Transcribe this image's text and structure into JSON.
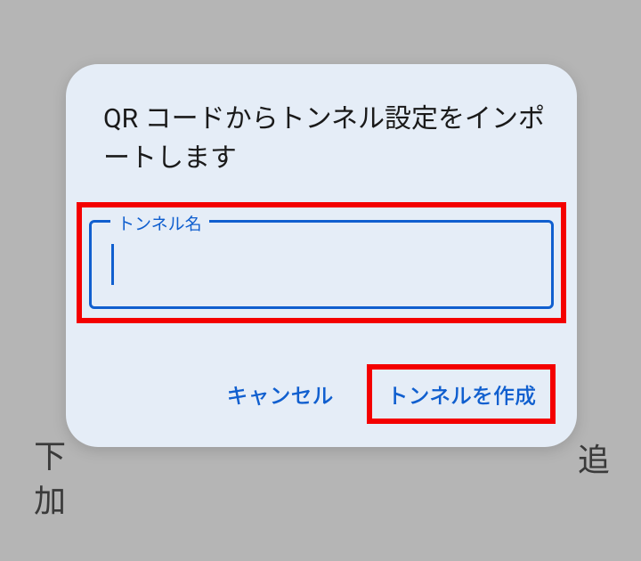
{
  "background": {
    "text_left": "下",
    "text_left2": "加",
    "text_right": "追"
  },
  "dialog": {
    "title": "QR コードからトンネル設定をインポートします",
    "input": {
      "label": "トンネル名",
      "value": ""
    },
    "actions": {
      "cancel": "キャンセル",
      "create": "トンネルを作成"
    }
  }
}
